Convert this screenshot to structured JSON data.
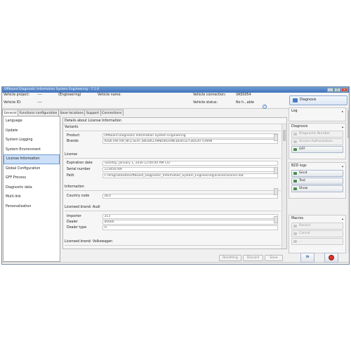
{
  "window": {
    "title": "Offboard Diagnostic Information System Engineering - 7.1.0",
    "controls": [
      "_",
      "□",
      "×"
    ]
  },
  "info": {
    "vehicle_project_label": "Vehicle project:",
    "vehicle_project_value": "----",
    "engineering": "(Engineering)",
    "vehicle_name_label": "Vehicle name:",
    "vehicle_id_label": "Vehicle ID:",
    "vehicle_id_value": "----",
    "vehicle_connection_label": "Vehicle connection:",
    "vehicle_connection_value": "VAS5054",
    "vehicle_status_label": "Vehicle status:",
    "vehicle_status_value": "No h...able",
    "help_glyph": "?",
    "diagnosis_button": "Diagnosis"
  },
  "tabs": [
    "General",
    "Functions configuration",
    "Save locations",
    "Support",
    "Connections"
  ],
  "nav": [
    "Language",
    "Update",
    "System Logging",
    "System Environment",
    "License Information",
    "Global Configuration",
    "GFF Process",
    "Diagnostic data",
    "Multi-link",
    "Personalization"
  ],
  "nav_selected_index": 4,
  "details": {
    "title": "Details about License Information",
    "variants_heading": "Variants",
    "product_label": "Product",
    "product_value": "Offboard Diagnostic Information System Engineering",
    "brands_label": "Brands",
    "brands_value": "AUDI,VW,VW_NFZ,SEAT,SKODA,LAMBORGHINI,BENTLEY,BUGATTI,MAN",
    "license_heading": "License",
    "expiration_label": "Expiration date",
    "expiration_value": "Tuesday, January 1, 2030 12:00:00 AM CST",
    "serial_label": "Serial number",
    "serial_value": "123456789",
    "path_label": "Path",
    "path_value": "C:\\ProgramData\\Offboard_Diagnostic_Information_System_Engineering\\license\\licence.dat",
    "information_heading": "Information",
    "country_label": "Country code",
    "country_value": "DEU",
    "audi_heading": "Licensed brand: Audi",
    "importer_label": "Importer",
    "importer_value": "313",
    "dealer_label": "Dealer",
    "dealer_value": "00000",
    "dealer_type_label": "Dealer type",
    "dealer_type_value": "H",
    "vw_heading": "Licensed brand: Volkswagen"
  },
  "actions": {
    "resetting": "Resetting",
    "discard": "Discard",
    "save": "Save"
  },
  "right_panel": {
    "log": "Log",
    "diagnosis": "Diagnosis",
    "diagnostic_number": "Diagnostic Number",
    "access_authorization": "Access Authorization",
    "gff": "GFF",
    "bzd_logs": "BZD logs",
    "send": "Send",
    "test": "Test",
    "show": "Show",
    "macros": "Macros",
    "record": "Record",
    "cancel": "Cancel",
    "more": "..."
  }
}
